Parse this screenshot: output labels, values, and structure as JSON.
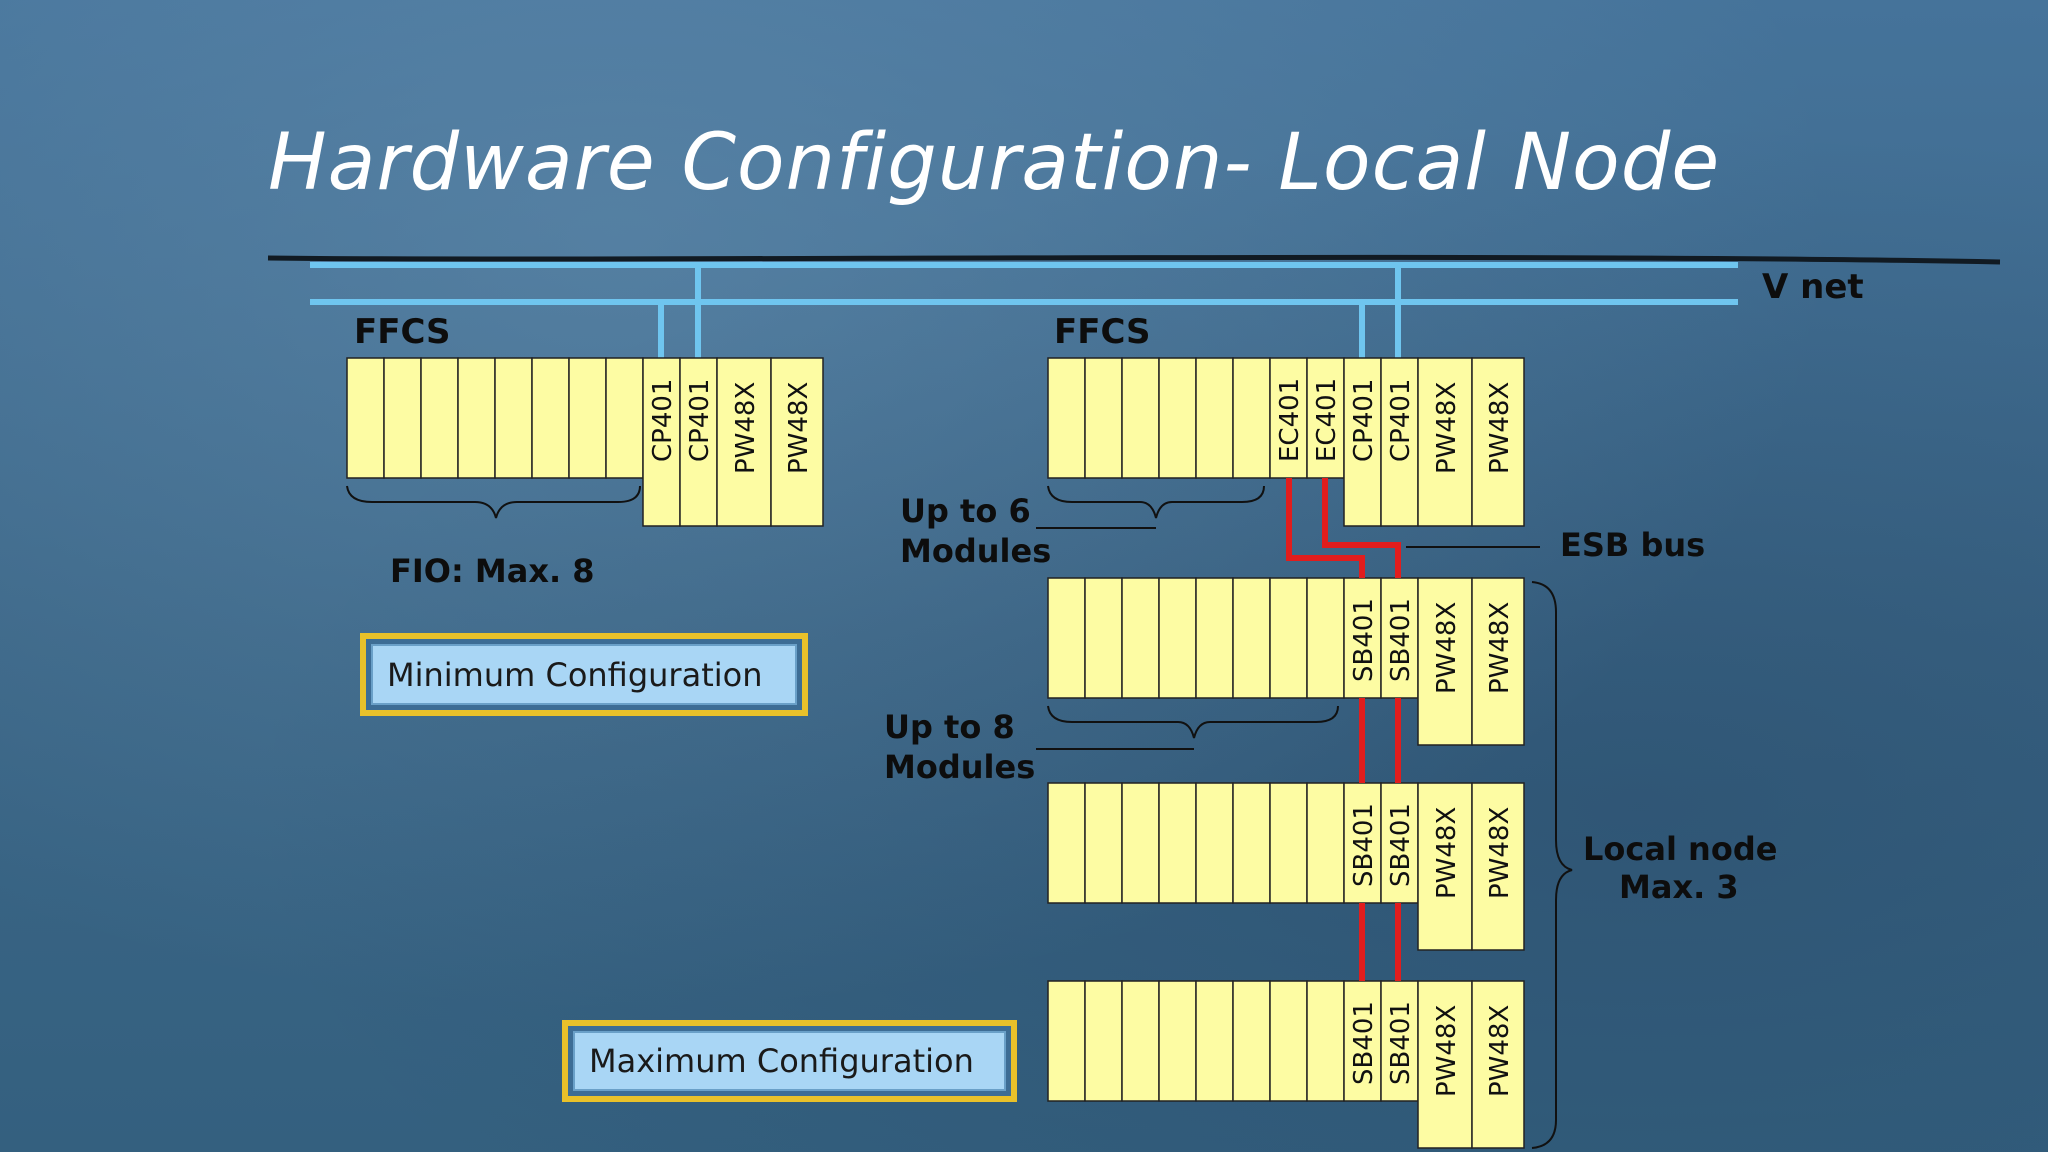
{
  "title": "Hardware Configuration- Local Node",
  "labels": {
    "vnet": "V net",
    "ffcs_left": "FFCS",
    "ffcs_right": "FFCS",
    "fio_max": "FIO: Max. 8",
    "up_to_6_line1": "Up to 6",
    "up_to_6_line2": "Modules",
    "up_to_8_line1": "Up to 8",
    "up_to_8_line2": "Modules",
    "esb_bus": "ESB bus",
    "local_node_line1": "Local node",
    "local_node_line2": "Max. 3"
  },
  "modules": {
    "cp401": "CP401",
    "ec401": "EC401",
    "sb401": "SB401",
    "pw48x": "PW48X"
  },
  "buttons": {
    "minimum": "Minimum Configuration",
    "maximum": "Maximum Configuration"
  },
  "colors": {
    "module_fill": "#fdfca3",
    "vnet_line": "#6fc5ef",
    "esb_line": "#e11d1d",
    "box_border": "#e9c12a"
  }
}
